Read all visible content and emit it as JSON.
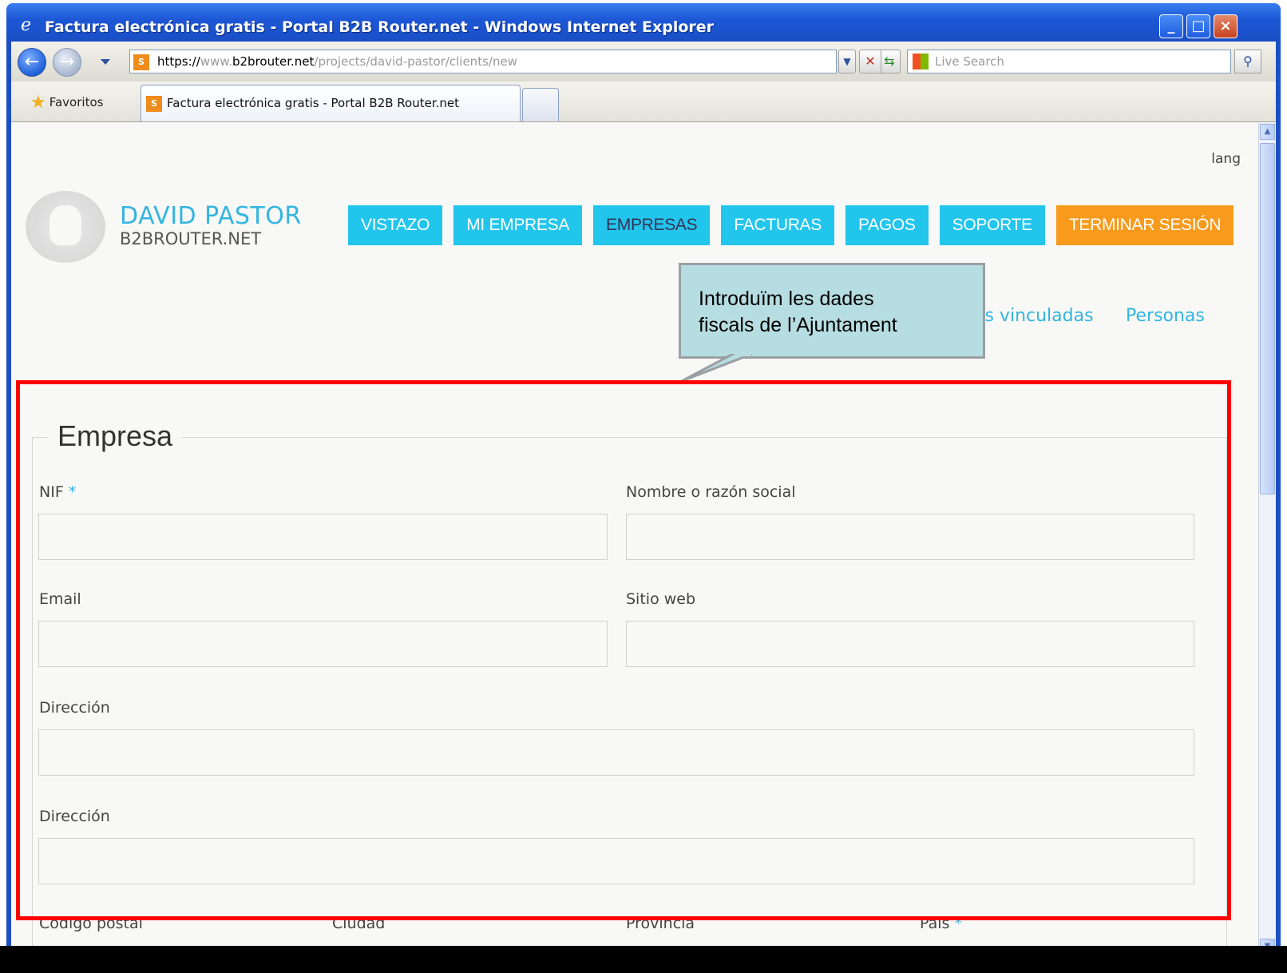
{
  "window": {
    "title": "Factura electrónica gratis - Portal B2B Router.net - Windows Internet Explorer",
    "controls": {
      "minimize": "_",
      "maximize": "□",
      "close": "×"
    }
  },
  "browser": {
    "address_main": "https://www.b2brouter.net",
    "address_prefix_protocol": "https://",
    "address_host_grey": "www.",
    "address_host": "b2brouter.net",
    "address_path": "/projects/david-pastor/clients/new",
    "search_placeholder": "Live Search",
    "favorites_label": "Favoritos",
    "tab_title": "Factura electrónica gratis - Portal B2B Router.net",
    "site_icon_text": "S"
  },
  "page": {
    "lang": "lang",
    "brand": {
      "name": "DAVID PASTOR",
      "sub": "B2BROUTER.NET"
    },
    "menu": [
      {
        "label": "VISTAZO",
        "state": "normal"
      },
      {
        "label": "MI EMPRESA",
        "state": "normal"
      },
      {
        "label": "EMPRESAS",
        "state": "active"
      },
      {
        "label": "FACTURAS",
        "state": "normal"
      },
      {
        "label": "PAGOS",
        "state": "normal"
      },
      {
        "label": "SOPORTE",
        "state": "normal"
      },
      {
        "label": "TERMINAR SESIÓN",
        "state": "logout"
      }
    ],
    "subnav": {
      "linked": "as vinculadas",
      "people": "Personas"
    },
    "callout": {
      "line1": "Introduïm les dades",
      "line2": "fiscals de l’Ajuntament"
    },
    "form": {
      "legend": "Empresa",
      "required_mark": "*",
      "fields": {
        "nif": {
          "label": "NIF",
          "value": ""
        },
        "name": {
          "label": "Nombre o razón social",
          "value": ""
        },
        "email": {
          "label": "Email",
          "value": ""
        },
        "website": {
          "label": "Sitio web",
          "value": ""
        },
        "address1": {
          "label": "Dirección",
          "value": ""
        },
        "address2": {
          "label": "Dirección",
          "value": ""
        },
        "postal_code": {
          "label": "Código postal"
        },
        "city": {
          "label": "Ciudad"
        },
        "province": {
          "label": "Provincia"
        },
        "country": {
          "label": "País"
        }
      }
    }
  },
  "colors": {
    "accent": "#22c5ec",
    "logout": "#f89a1c",
    "brand_text": "#33b5e0",
    "highlight_frame": "#ff0000",
    "callout_bg": "#b6dde1"
  }
}
